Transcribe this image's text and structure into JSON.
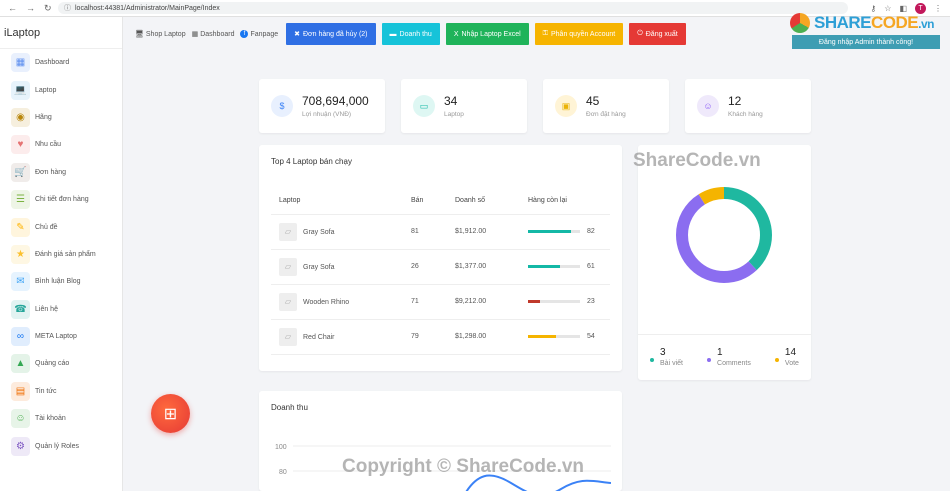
{
  "browser": {
    "url": "localhost:44381/Administrator/MainPage/Index",
    "profile_initial": "T"
  },
  "sidebar": {
    "brand": "iLaptop",
    "items": [
      {
        "label": "Dashboard",
        "icon": "dashboard-icon",
        "color": "#5b8def"
      },
      {
        "label": "Laptop",
        "icon": "laptop-icon",
        "color": "#4aa3df"
      },
      {
        "label": "Hãng",
        "icon": "brand-icon",
        "color": "#b8860b"
      },
      {
        "label": "Nhu cầu",
        "icon": "needs-icon",
        "color": "#e57373"
      },
      {
        "label": "Đơn hàng",
        "icon": "orders-icon",
        "color": "#8d6e63"
      },
      {
        "label": "Chi tiết đơn hàng",
        "icon": "order-detail-icon",
        "color": "#7cb342"
      },
      {
        "label": "Chủ đề",
        "icon": "topic-icon",
        "color": "#ffb300"
      },
      {
        "label": "Đánh giá sản phẩm",
        "icon": "rating-icon",
        "color": "#fbc02d"
      },
      {
        "label": "Bình luận Blog",
        "icon": "comment-icon",
        "color": "#42a5f5"
      },
      {
        "label": "Liên hệ",
        "icon": "contact-icon",
        "color": "#26a69a"
      },
      {
        "label": "META Laptop",
        "icon": "meta-icon",
        "color": "#1877f2"
      },
      {
        "label": "Quảng cáo",
        "icon": "ads-icon",
        "color": "#34a853"
      },
      {
        "label": "Tin tức",
        "icon": "news-icon",
        "color": "#ef6c00"
      },
      {
        "label": "Tài khoản",
        "icon": "account-icon",
        "color": "#4caf50"
      },
      {
        "label": "Quản lý Roles",
        "icon": "roles-icon",
        "color": "#7e57c2"
      }
    ]
  },
  "topnav": {
    "links": [
      {
        "label": "Shop Laptop",
        "icon": "shop-icon"
      },
      {
        "label": "Dashboard",
        "icon": "dashboard-icon"
      },
      {
        "label": "Fanpage",
        "icon": "facebook-icon"
      }
    ],
    "buttons": [
      {
        "label": "Đơn hàng đã hủy (2)",
        "color": "#2f6fe4",
        "icon": "cancelled-icon"
      },
      {
        "label": "Doanh thu",
        "color": "#16c3d9",
        "icon": "revenue-icon"
      },
      {
        "label": "Nhập Laptop Excel",
        "color": "#1fb35a",
        "icon": "excel-icon"
      },
      {
        "label": "Phân quyền Account",
        "color": "#f6b400",
        "icon": "permission-icon"
      },
      {
        "label": "Đăng xuất",
        "color": "#e53935",
        "icon": "logout-icon"
      }
    ]
  },
  "toast": {
    "message": "Đăng nhập Admin thành công!"
  },
  "logo": {
    "prefix": "SHARE",
    "suffix": "CODE",
    "tail": ".vn"
  },
  "stats": [
    {
      "value": "708,694,000",
      "label": "Lợi nhuận (VNĐ)",
      "icon": "dollar-icon",
      "bg": "#e8f0fe",
      "fg": "#3b82f6"
    },
    {
      "value": "34",
      "label": "Laptop",
      "icon": "laptop-icon",
      "bg": "#def7f3",
      "fg": "#14b8a6"
    },
    {
      "value": "45",
      "label": "Đơn đặt hàng",
      "icon": "order-icon",
      "bg": "#fff4d6",
      "fg": "#eab308"
    },
    {
      "value": "12",
      "label": "Khách hàng",
      "icon": "user-icon",
      "bg": "#efe9fb",
      "fg": "#8b5cf6"
    }
  ],
  "top_laptops": {
    "title": "Top 4 Laptop bán chạy",
    "headers": [
      "Laptop",
      "Bán",
      "Doanh số",
      "Hàng còn lại"
    ],
    "rows": [
      {
        "name": "Gray Sofa",
        "sold": "81",
        "revenue": "$1,912.00",
        "remaining": 82,
        "color": "#14b8a6"
      },
      {
        "name": "Gray Sofa",
        "sold": "26",
        "revenue": "$1,377.00",
        "remaining": 61,
        "color": "#14b8a6"
      },
      {
        "name": "Wooden Rhino",
        "sold": "71",
        "revenue": "$9,212.00",
        "remaining": 23,
        "color": "#c0392b"
      },
      {
        "name": "Red Chair",
        "sold": "79",
        "revenue": "$1,298.00",
        "remaining": 54,
        "color": "#f5b400"
      }
    ]
  },
  "donut": {
    "segments": [
      {
        "name": "Bài viết",
        "value": 3,
        "color": "#1fb8a0"
      },
      {
        "name": "Comments",
        "value": 1,
        "color": "#8b6df0"
      },
      {
        "name": "Vote",
        "value": 14,
        "color": "#f5b400"
      }
    ],
    "arc_fractions": [
      0.38,
      0.53,
      0.09
    ]
  },
  "revenue": {
    "title": "Doanh thu",
    "y_ticks": [
      "100",
      "80"
    ]
  },
  "watermarks": {
    "top": "ShareCode.vn",
    "bottom": "Copyright © ShareCode.vn"
  }
}
